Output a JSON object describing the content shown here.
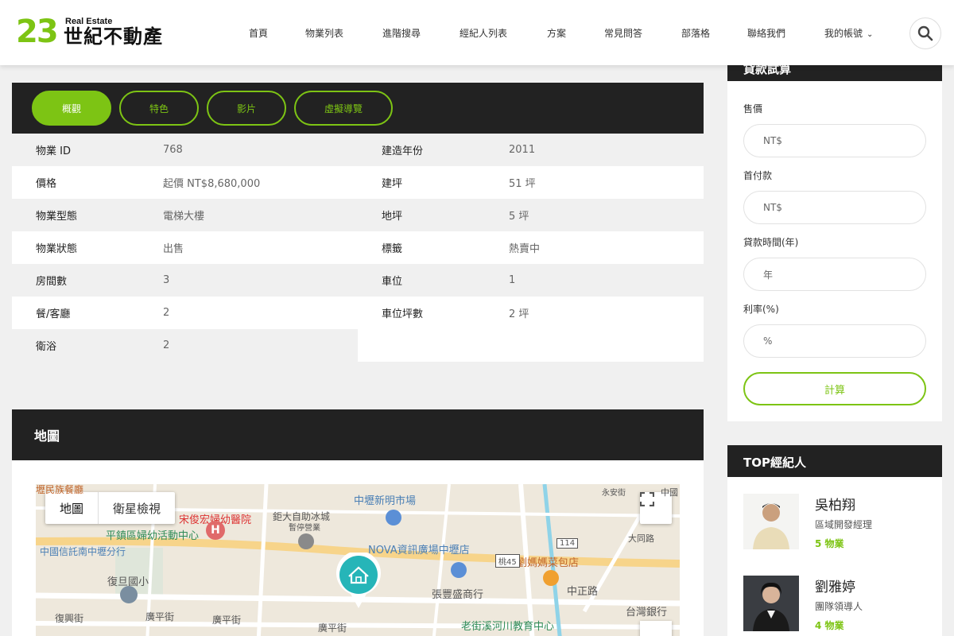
{
  "header": {
    "logo_number": "23",
    "logo_sub": "Real Estate",
    "logo_name": "世紀不動產",
    "nav": [
      {
        "label": "首頁"
      },
      {
        "label": "物業列表"
      },
      {
        "label": "進階搜尋"
      },
      {
        "label": "經紀人列表"
      },
      {
        "label": "方案"
      },
      {
        "label": "常見問答"
      },
      {
        "label": "部落格"
      },
      {
        "label": "聯絡我們"
      },
      {
        "label": "我的帳號"
      }
    ],
    "search_icon": "search-icon"
  },
  "tabs": [
    {
      "label": "概觀",
      "active": true
    },
    {
      "label": "特色"
    },
    {
      "label": "影片"
    },
    {
      "label": "虛擬導覽"
    }
  ],
  "details_left": [
    {
      "key": "物業 ID",
      "value": "768"
    },
    {
      "key": "價格",
      "value": "起價 NT$8,680,000"
    },
    {
      "key": "物業型態",
      "value": "電梯大樓"
    },
    {
      "key": "物業狀態",
      "value": "出售"
    },
    {
      "key": "房間數",
      "value": "3"
    },
    {
      "key": "餐/客廳",
      "value": "2"
    },
    {
      "key": "衛浴",
      "value": "2"
    }
  ],
  "details_right": [
    {
      "key": "建造年份",
      "value": "2011"
    },
    {
      "key": "建坪",
      "value": "51 坪"
    },
    {
      "key": "地坪",
      "value": "5 坪"
    },
    {
      "key": "標籤",
      "value": "熱賣中"
    },
    {
      "key": "車位",
      "value": "1"
    },
    {
      "key": "車位坪數",
      "value": "2 坪"
    }
  ],
  "map": {
    "title": "地圖",
    "type_map": "地圖",
    "type_satellite": "衛星檢視",
    "labels": [
      "壢民族餐廳",
      "宋俊宏婦幼醫院",
      "中壢新明市場",
      "鉅大自助冰城",
      "暫停營業",
      "平鎮區婦幼活動中心",
      "中國信託南中壢分行",
      "NOVA資訊廣場中壢店",
      "劉媽媽菜包店",
      "復旦國小",
      "張豐盛商行",
      "中正路",
      "台灣銀行",
      "老街溪河川教育中心",
      "復興街",
      "廣平街",
      "廣平街",
      "廣平街",
      "永安街",
      "中國",
      "大同路",
      "114",
      "桃45"
    ]
  },
  "calculator": {
    "title": "貸款試算",
    "fields": [
      {
        "label": "售價",
        "placeholder": "NT$"
      },
      {
        "label": "首付款",
        "placeholder": "NT$"
      },
      {
        "label": "貸款時間(年)",
        "placeholder": "年"
      },
      {
        "label": "利率(%)",
        "placeholder": "%"
      }
    ],
    "button": "計算"
  },
  "agents": {
    "title": "TOP經紀人",
    "list": [
      {
        "name": "吳柏翔",
        "role": "區域開發經理",
        "count": "5 物業"
      },
      {
        "name": "劉雅婷",
        "role": "團隊領導人",
        "count": "4 物業"
      }
    ]
  },
  "colors": {
    "accent": "#7dc414",
    "dark": "#222222",
    "map_pin": "#26b5b8"
  }
}
